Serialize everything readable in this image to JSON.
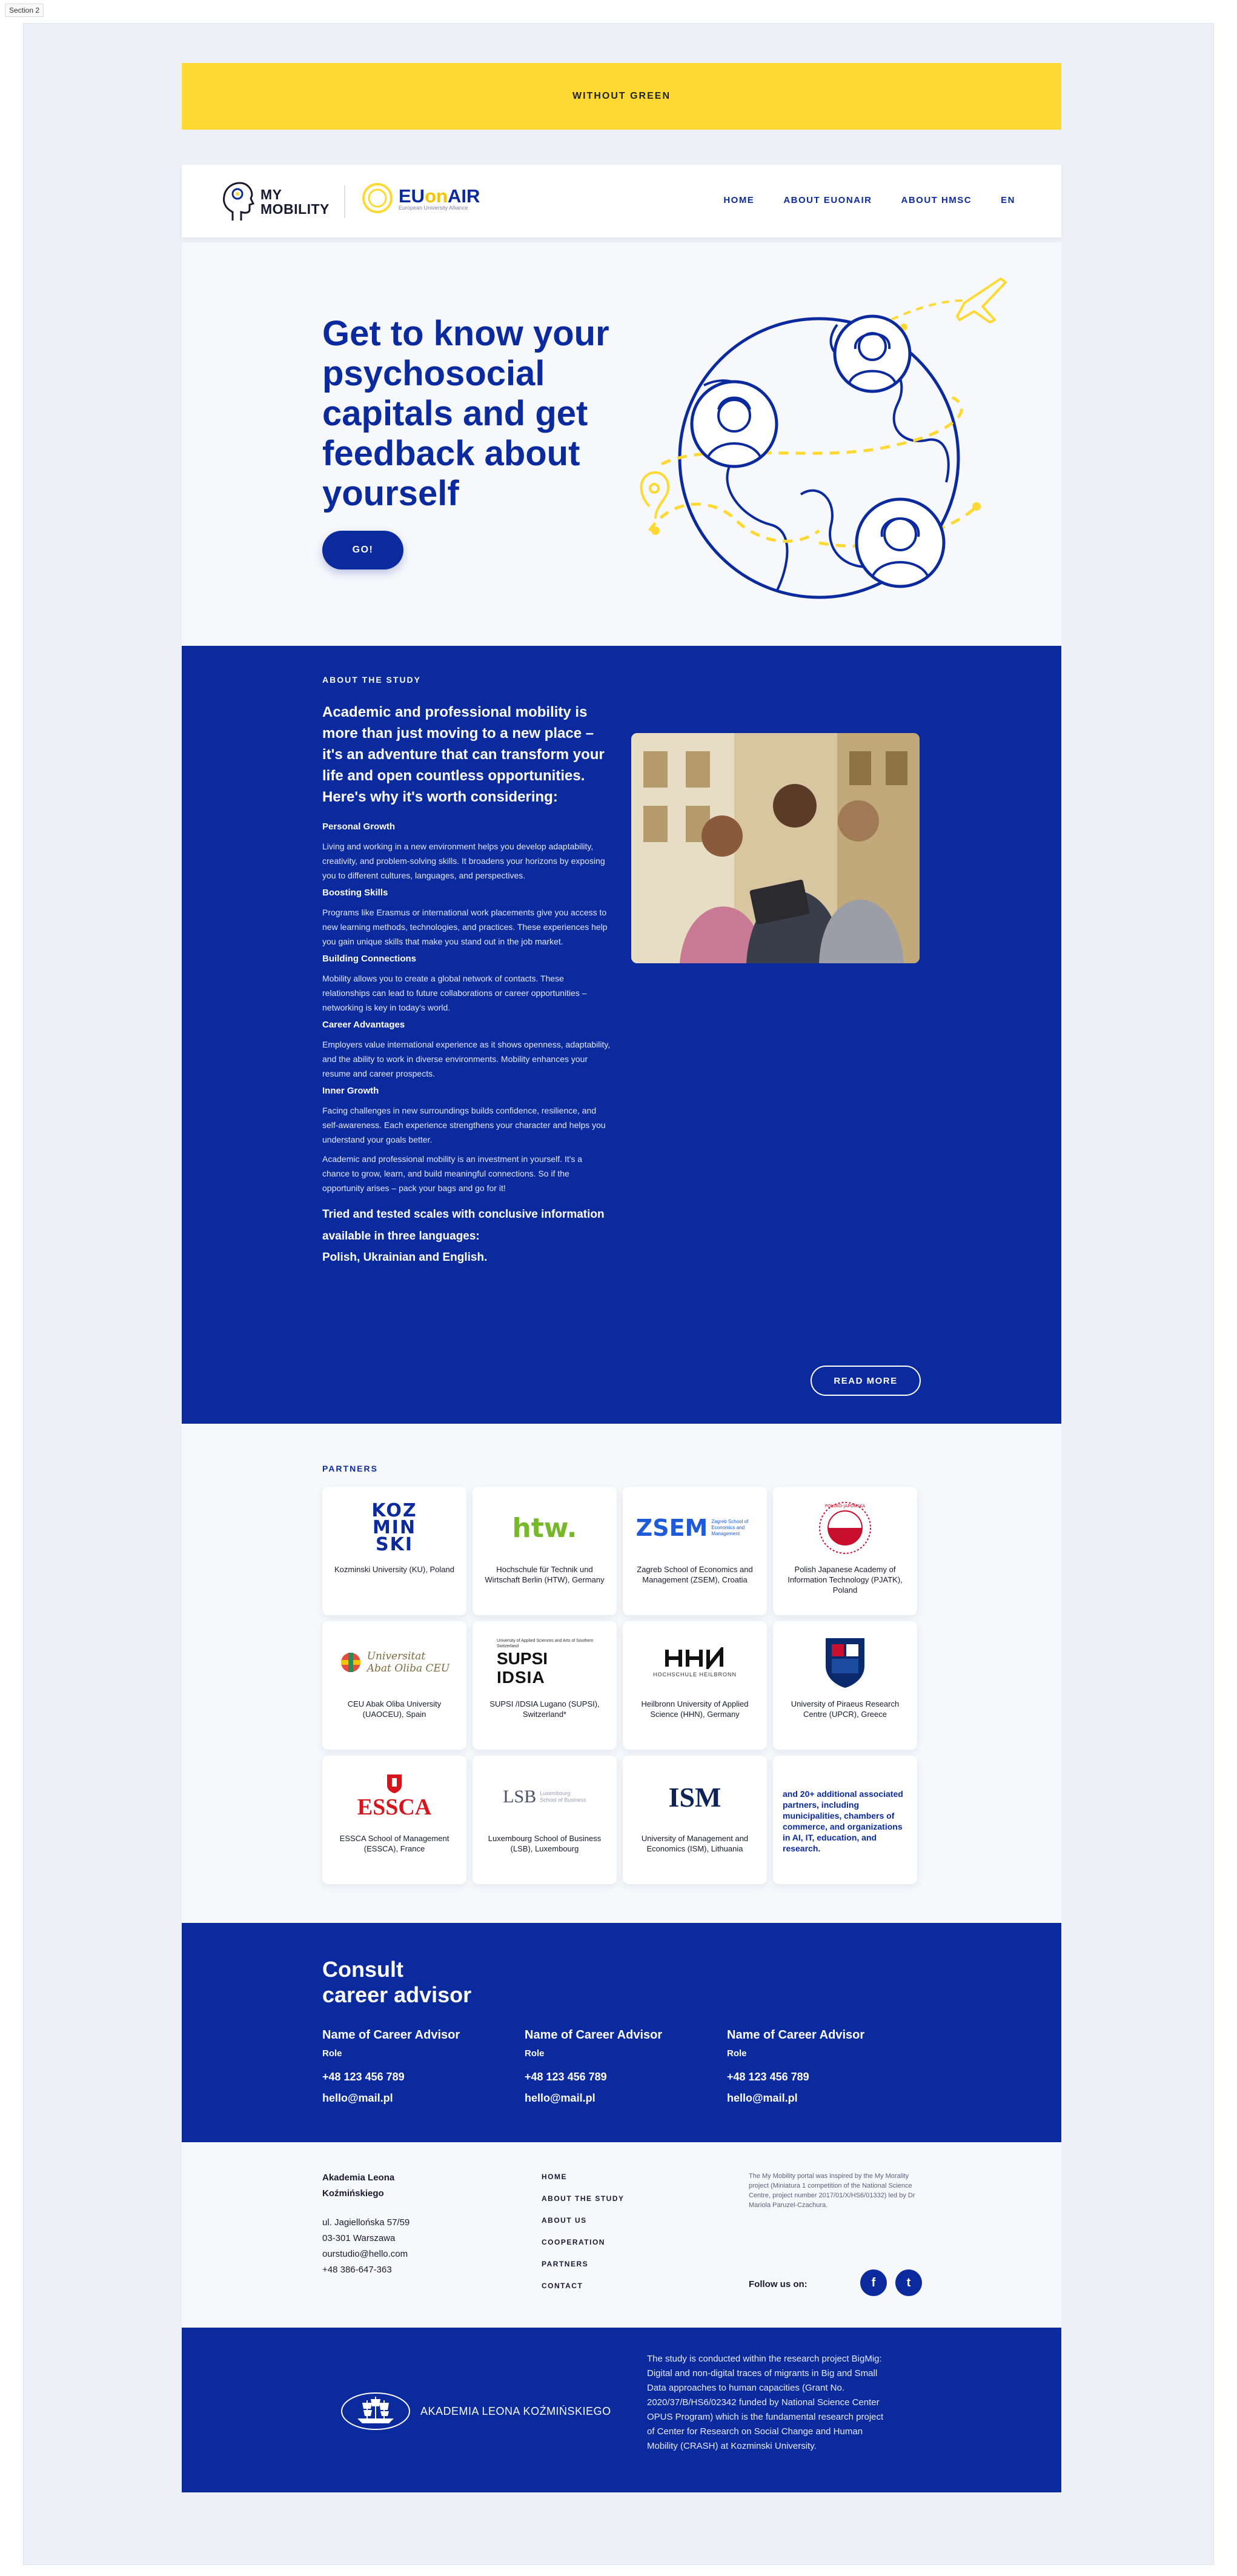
{
  "section_tag": "Section 2",
  "banner": {
    "text": "WITHOUT GREEN"
  },
  "nav": {
    "logo_mm_line1": "MY",
    "logo_mm_line2": "MOBILITY",
    "logo_eu_part1": "EU",
    "logo_eu_part2": "on",
    "logo_eu_part3": "AIR",
    "logo_eu_sub": "European University Alliance",
    "links": [
      "HOME",
      "ABOUT EUONAIR",
      "ABOUT  HMSC",
      "EN"
    ]
  },
  "hero": {
    "title": "Get to know your psychosocial capitals and get feedback about yourself",
    "button": "GO!"
  },
  "about": {
    "eyebrow": "ABOUT THE STUDY",
    "lead": "Academic and professional mobility is more than just moving to a new place – it's an adventure that can transform your life and open countless opportunities. Here's why it's worth considering:",
    "items": [
      {
        "title": "Personal Growth",
        "text": "Living and working in a new environment helps you develop adaptability, creativity, and problem-solving skills. It broadens your horizons by exposing you to different cultures, languages, and perspectives."
      },
      {
        "title": "Boosting Skills",
        "text": "Programs like Erasmus or international work placements give you access to new learning methods, technologies, and practices. These experiences help you gain unique skills that make you stand out in the job market."
      },
      {
        "title": "Building Connections",
        "text": "Mobility allows you to create a global network of contacts. These relationships can lead to future collaborations or career opportunities – networking is key in today's world."
      },
      {
        "title": "Career Advantages",
        "text": "Employers value international experience as it shows openness, adaptability, and the ability to work in diverse environments. Mobility enhances your resume and career prospects."
      },
      {
        "title": "Inner Growth",
        "text": "Facing challenges in new surroundings builds confidence, resilience, and self-awareness. Each experience strengthens your character and helps you understand your goals better."
      }
    ],
    "summary": "Academic and professional mobility is an investment in yourself. It's a chance to grow, learn, and build meaningful connections. So if the opportunity arises – pack your bags and go for it!",
    "closing": "Tried and tested scales with conclusive information available in three languages:",
    "closing2": "Polish, Ukrainian and English.",
    "button": "READ MORE"
  },
  "partners": {
    "eyebrow": "PARTNERS",
    "cards": [
      {
        "logo": "KOZMINSKI",
        "caption": "Kozminski University (KU), Poland"
      },
      {
        "logo": "htw.",
        "caption": "Hochschule für Technik und Wirtschaft Berlin (HTW), Germany"
      },
      {
        "logo": "ZSEM",
        "caption": "Zagreb School of Economics and Management (ZSEM), Croatia"
      },
      {
        "logo": "PJATK",
        "caption": "Polish Japanese Academy of Information Technology (PJATK), Poland"
      },
      {
        "logo": "Universitat Abat Oliba CEU",
        "caption": "CEU Abak Oliba University (UAOCEU), Spain"
      },
      {
        "logo": "SUPSI IDSIA",
        "caption": "SUPSI /IDSIA Lugano (SUPSI), Switzerland*"
      },
      {
        "logo": "HHN",
        "caption": "Heilbronn University of Applied Science (HHN), Germany"
      },
      {
        "logo": "UPCR",
        "caption": "University of Piraeus Research Centre (UPCR), Greece"
      },
      {
        "logo": "ESSCA",
        "caption": "ESSCA School of Management (ESSCA), France"
      },
      {
        "logo": "LSB",
        "caption": "Luxembourg School of Business (LSB), Luxembourg"
      },
      {
        "logo": "ISM",
        "caption": "University of Management and Economics (ISM), Lithuania"
      }
    ],
    "more": "and 20+ additional associated partners, including municipalities, chambers of commerce, and organizations in AI, IT, education, and research.",
    "logo_texts": {
      "kozminski": [
        "KOZ",
        "MIN",
        "SKI"
      ],
      "zsem_sub": "Zagreb School of Economics and Management",
      "pjatk_ring": "POLSKO-JAPOŃSKA",
      "abat": [
        "Universitat",
        "Abat Oliba CEU"
      ],
      "supsi_top": "University of Applied Sciences and Arts of Southern Switzerland",
      "supsi": "SUPSI",
      "idsia": "IDSIA",
      "hhn_sub": "HOCHSCHULE HEILBRONN",
      "lsb_sub": [
        "Luxembourg",
        "School of Business"
      ]
    }
  },
  "consult": {
    "title_line1": "Consult",
    "title_line2": "career advisor",
    "advisors": [
      {
        "name": "Name of Career Advisor",
        "role": "Role",
        "phone": "+48 123 456 789",
        "email": "hello@mail.pl"
      },
      {
        "name": "Name of Career Advisor",
        "role": "Role",
        "phone": "+48 123 456 789",
        "email": "hello@mail.pl"
      },
      {
        "name": "Name of Career Advisor",
        "role": "Role",
        "phone": "+48 123 456 789",
        "email": "hello@mail.pl"
      }
    ]
  },
  "footer": {
    "org_line1": "Akademia Leona",
    "org_line2": "Koźmińskiego",
    "street": "ul. Jagiellońska 57/59",
    "city": "03-301 Warszawa",
    "email": "ourstudio@hello.com",
    "phone": "+48 386-647-363",
    "links": [
      "HOME",
      "ABOUT THE STUDY",
      "ABOUT US",
      "COOPERATION",
      "PARTNERS",
      "CONTACT"
    ],
    "note": "The My Mobility portal was inspired by the My Morality project (Miniatura 1 competition of the National Science Centre, project number 2017/01/X/HS6/01332) led by Dr Mariola Paruzel-Czachura.",
    "follow": "Follow us on:",
    "social": [
      "f",
      "t"
    ]
  },
  "bottom": {
    "logo_text": "AKADEMIA LEONA KOŹMIŃSKIEGO",
    "text": "The study is conducted within the research project BigMig: Digital and non-digital traces of migrants in Big and Small Data approaches to human capacities (Grant No. 2020/37/B/HS6/02342 funded by National Science Center OPUS Program) which is the fundamental research project of Center for Research on Social Change and Human Mobility (CRASH) at Kozminski University."
  },
  "colors": {
    "brand": "#0b2a9d",
    "accent": "#ffd933",
    "bg": "#f7f8fc"
  }
}
